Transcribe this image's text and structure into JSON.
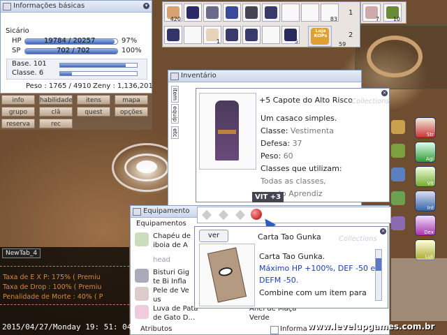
{
  "basic_info": {
    "title": "Informações básicas",
    "job": "Sicário",
    "hp_label": "HP",
    "hp_value": "19784 / 20257",
    "hp_pct": "97%",
    "hp_fraction": 0.97,
    "sp_label": "SP",
    "sp_value": "702 / 702",
    "sp_pct": "100%",
    "sp_fraction": 1.0,
    "base_level": "Base. 101",
    "base_fraction": 0.85,
    "job_level": "Classe. 6",
    "job_fraction": 0.15,
    "weight": "Peso : 1765 / 4910",
    "zeny": "Zeny : 1,136,201",
    "menu": [
      "info",
      "habilidade",
      "itens",
      "mapa",
      "grupo",
      "clã",
      "quest",
      "opções",
      "reserva",
      "rec"
    ]
  },
  "hotbar": {
    "row1_counts": [
      "420",
      "",
      "",
      "",
      "",
      "",
      "",
      "",
      "",
      "",
      "83"
    ],
    "row1_index": "1",
    "row2_counts": [
      "",
      "",
      "",
      "1",
      "",
      "",
      "",
      "",
      "",
      "5",
      "59"
    ],
    "row2_index": "2",
    "extra_counts": [
      "7",
      "10"
    ],
    "shop_label": "Loja KOPs"
  },
  "inventory": {
    "title": "Inventário",
    "tabs": [
      "item",
      "equip",
      "etc"
    ],
    "tooltip_title": "+5 Capote do Alto Risco",
    "ghost_text": "Collections",
    "lines": [
      "Um casaco simples.",
      "Classe: ",
      "Defesa: ",
      "Peso: ",
      "Classes que utilizam:",
      "Todas as classes,",
      "exceto Aprendiz"
    ],
    "class_value": "Vestimenta",
    "def_value": "37",
    "weight_value": "60",
    "badge": "VIT +3"
  },
  "equipment": {
    "title": "Equipamento",
    "header": "Equipamentos",
    "items": [
      "Chapéu de",
      "iboia de A",
      "head",
      "Bisturi Gig",
      "te Bi Infla",
      "Pele de Ve",
      "us",
      "Luva de Pata",
      "de Gato D..."
    ],
    "right_items": [
      "Anel de Maçã",
      "Verde"
    ],
    "footer": "Atributos",
    "footer_right": "Informa",
    "card_tooltip": {
      "btn": "ver",
      "name": "Carta Tao Gunka",
      "ghost_text": "Collections",
      "line1": "Carta Tao Gunka.",
      "line2": "Máximo HP +100%, DEF -50 e",
      "line3": "DEFM -50.",
      "line4": "Combine com um item para"
    }
  },
  "chat": {
    "tab": "NewTab_4",
    "lines": [
      "Taxa de E X P: 175% ( Premiu",
      "Taxa de Drop : 100% ( Premiu",
      "Penalidade de Morte : 40% ( P"
    ],
    "timestamp": "2015/04/27/Monday  19: 51: 04"
  },
  "stat_buttons": [
    "Str",
    "Agi",
    "Vit",
    "Int",
    "Dex",
    "Luk"
  ],
  "watermark": "www.levelupgames.com.br",
  "colors": {
    "accent": "#3f63b8",
    "ui_border": "#8aa0c0",
    "chat_text": "#d88a3a",
    "blue_text": "#1a3fb0"
  }
}
